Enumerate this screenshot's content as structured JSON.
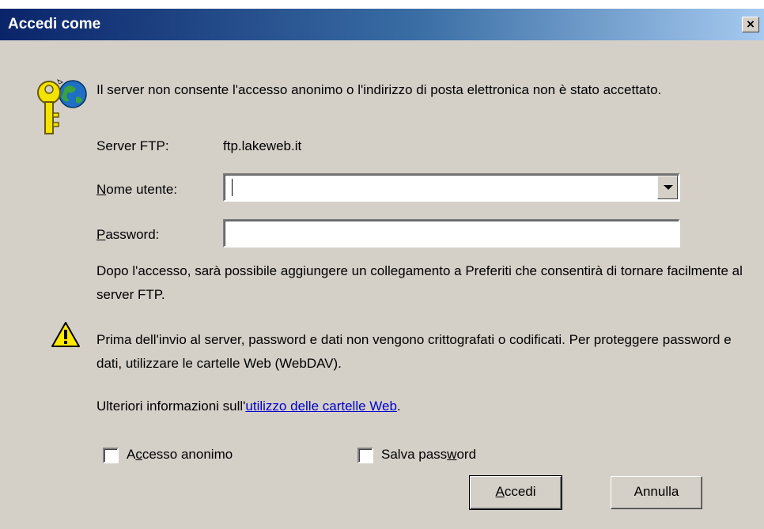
{
  "window": {
    "title": "Accedi come",
    "close_symbol": "×"
  },
  "message": "Il server non consente l'accesso anonimo o l'indirizzo di posta elettronica non è stato accettato.",
  "server": {
    "label": "Server FTP:",
    "value": "ftp.lakeweb.it"
  },
  "username": {
    "label_access_key": "N",
    "label_rest": "ome utente:",
    "value": ""
  },
  "password": {
    "label_access_key": "P",
    "label_rest": "assword:",
    "value": ""
  },
  "info_text": "Dopo l'accesso, sarà possibile aggiungere un collegamento a Preferiti che consentirà di tornare facilmente al server FTP.",
  "warning_text": "Prima dell'invio al server, password e dati non vengono crittografati o codificati. Per proteggere password e dati, utilizzare le cartelle Web (WebDAV).",
  "more_info": {
    "prefix": "Ulteriori informazioni sull'",
    "link_text": "utilizzo delle cartelle Web",
    "suffix": "."
  },
  "anonymous_checkbox": {
    "pre": "A",
    "access_key": "c",
    "post": "cesso anonimo",
    "checked": false
  },
  "save_password_checkbox": {
    "pre": "Salva pass",
    "access_key": "w",
    "post": "ord",
    "checked": false
  },
  "buttons": {
    "login": {
      "access_key": "A",
      "rest": "ccedi"
    },
    "cancel": "Annulla"
  },
  "icons": {
    "login": "key-globe-icon",
    "warning": "warning-icon"
  },
  "colors": {
    "titlebar_start": "#0a246a",
    "titlebar_end": "#a6caf0",
    "dialog_bg": "#d4d0c8",
    "link": "#0000cc"
  }
}
